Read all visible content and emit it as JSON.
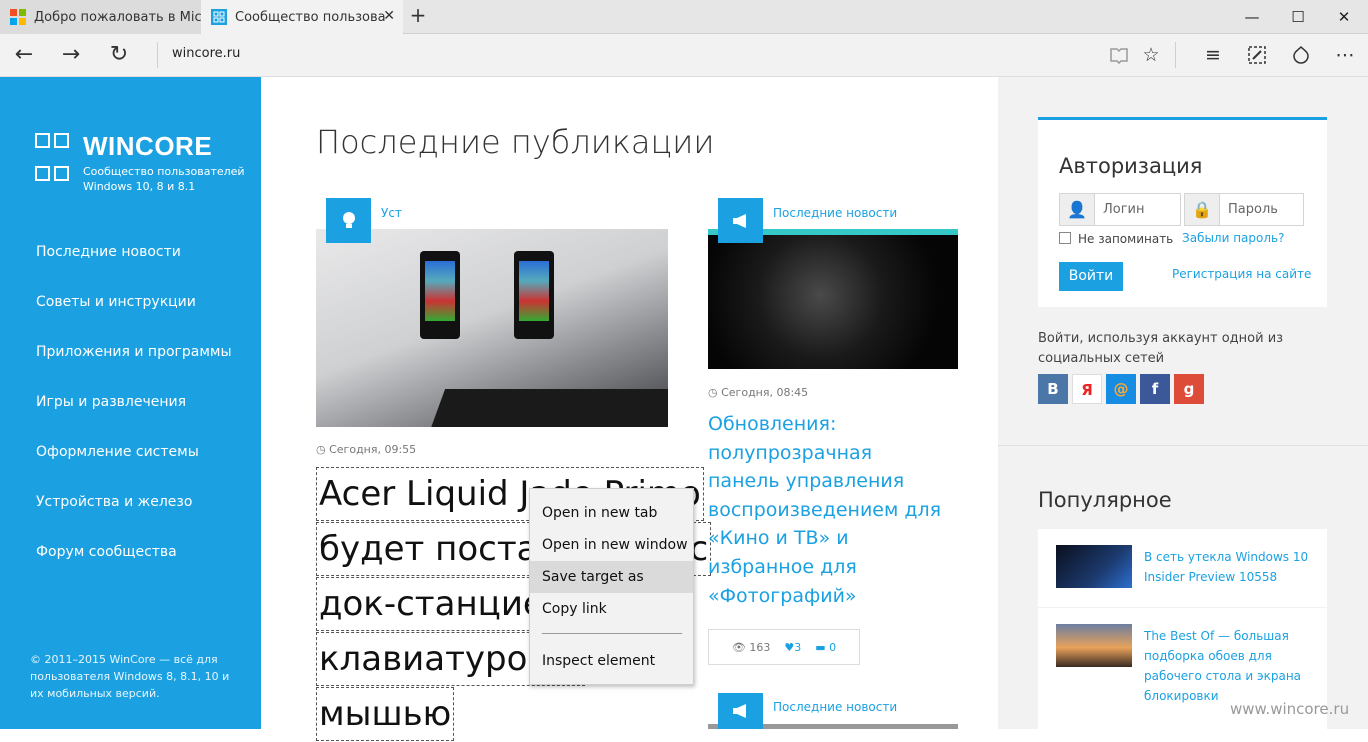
{
  "browser": {
    "tabs": [
      {
        "title": "Добро пожаловать в Micr"
      },
      {
        "title": "Сообщество пользова"
      }
    ],
    "new_tab_glyph": "+",
    "window_controls": {
      "minimize": "—",
      "maximize": "☐",
      "close": "✕"
    },
    "url": "wincore.ru",
    "tab_close_glyph": "✕"
  },
  "sidebar": {
    "logo_title": "WINCORE",
    "logo_sub_line1": "Сообщество пользователей",
    "logo_sub_line2": "Windows 10, 8 и 8.1",
    "menu": [
      "Последние новости",
      "Советы и инструкции",
      "Приложения и программы",
      "Игры и развлечения",
      "Оформление системы",
      "Устройства и железо",
      "Форум сообщества"
    ],
    "copyright": "© 2011–2015 WinCore — всё для пользователя Windows 8, 8.1, 10 и их мобильных версий."
  },
  "main": {
    "heading": "Последние публикации",
    "post1": {
      "category": "Уст",
      "time": "Сегодня, 09:55",
      "title_lines": [
        "Acer Liquid Jade Primo",
        "будет поставляться с",
        "док-станцией,",
        "клавиатурой и",
        "мышью"
      ]
    },
    "post2": {
      "category": "Последние новости",
      "time": "Сегодня, 08:45",
      "title": "Обновления: полупрозрачная панель управления воспроизведением для «Кино и ТВ» и избранное для «Фотографий»",
      "views": "163",
      "likes": "3",
      "comments": "0"
    },
    "post3": {
      "category": "Последние новости"
    }
  },
  "context_menu": {
    "items": [
      "Open in new tab",
      "Open in new window",
      "Save target as",
      "Copy link",
      "Inspect element"
    ]
  },
  "right": {
    "auth_title": "Авторизация",
    "login_placeholder": "Логин",
    "password_placeholder": "Пароль",
    "remember_label": "Не запоминать",
    "forgot_link": "Забыли пароль?",
    "login_button": "Войти",
    "register_link": "Регистрация на сайте",
    "social_text": "Войти, используя аккаунт одной из социальных сетей",
    "social": [
      {
        "label": "В",
        "color": "#4a76a8"
      },
      {
        "label": "Я",
        "color": "#ffffff"
      },
      {
        "label": "@",
        "color": "#168de2"
      },
      {
        "label": "f",
        "color": "#3b5998"
      },
      {
        "label": "g",
        "color": "#dd4b39"
      }
    ],
    "popular_title": "Популярное",
    "popular": [
      {
        "title": "В сеть утекла Windows 10 Insider Preview 10558"
      },
      {
        "title": "The Best Of — большая подборка обоев для рабочего стола и экрана блокировки"
      }
    ],
    "watermark": "www.wincore.ru"
  },
  "colors": {
    "accent": "#1ba1e2"
  }
}
